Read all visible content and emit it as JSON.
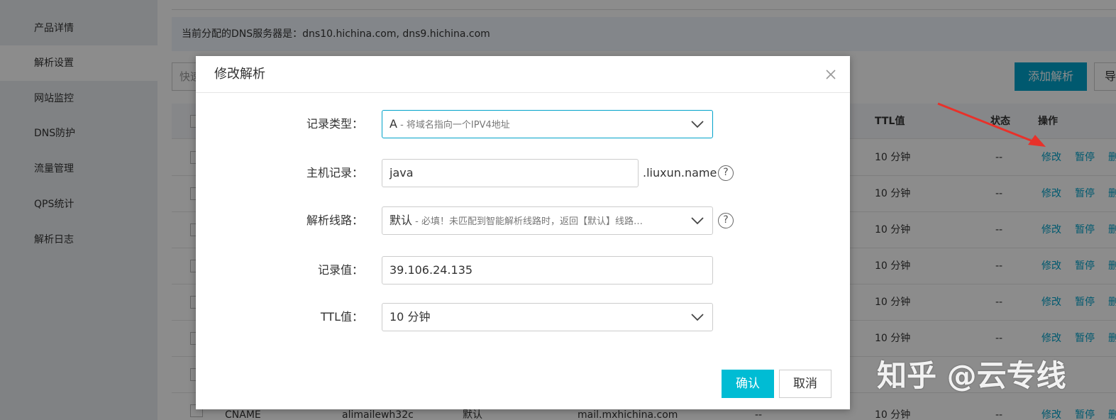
{
  "sidebar": {
    "items": [
      {
        "label": "产品详情"
      },
      {
        "label": "解析设置"
      },
      {
        "label": "网站监控"
      },
      {
        "label": "DNS防护"
      },
      {
        "label": "流量管理"
      },
      {
        "label": "QPS统计"
      },
      {
        "label": "解析日志"
      }
    ],
    "active_index": 1
  },
  "notice": {
    "text": "当前分配的DNS服务器是：dns10.hichina.com, dns9.hichina.com"
  },
  "toolbar": {
    "search_placeholder": "快速",
    "add_label": "添加解析",
    "export_label": "导"
  },
  "table": {
    "headers": {
      "ttl": "TTL值",
      "status": "状态",
      "actions": "操作"
    },
    "rows": [
      {
        "ttl": "10 分钟",
        "status": "--"
      },
      {
        "ttl": "10 分钟",
        "status": "--"
      },
      {
        "ttl": "10 分钟",
        "status": "--"
      },
      {
        "ttl": "10 分钟",
        "status": "--"
      },
      {
        "ttl": "10 分钟",
        "status": "--"
      },
      {
        "ttl": "10 分钟",
        "status": "--"
      },
      {
        "ttl": "",
        "status": ""
      },
      {
        "type": "CNAME",
        "host": "alimailewh32c",
        "line": "默认",
        "value": "mail.mxhichina.com",
        "mx": "--",
        "ttl": "10 分钟",
        "status": "--"
      }
    ],
    "row_actions": {
      "edit": "修改",
      "pause": "暂停",
      "delete": "删除"
    }
  },
  "modal": {
    "title": "修改解析",
    "fields": {
      "record_type": {
        "label": "记录类型：",
        "value": "A",
        "hint": " - 将域名指向一个IPV4地址"
      },
      "host": {
        "label": "主机记录：",
        "value": "java",
        "suffix": ".liuxun.name",
        "help": "?"
      },
      "line": {
        "label": "解析线路：",
        "value": "默认",
        "hint": " - 必填！未匹配到智能解析线路时，返回【默认】线路…",
        "help": "?"
      },
      "record_value": {
        "label": "记录值：",
        "value": "39.106.24.135"
      },
      "ttl": {
        "label": "TTL值：",
        "value": "10 分钟"
      }
    },
    "confirm_label": "确认",
    "cancel_label": "取消"
  },
  "watermark": {
    "text": "知乎 @云专线"
  },
  "colors": {
    "accent": "#00a2ca",
    "confirm": "#00bcd4",
    "arrow": "#e8312a"
  }
}
